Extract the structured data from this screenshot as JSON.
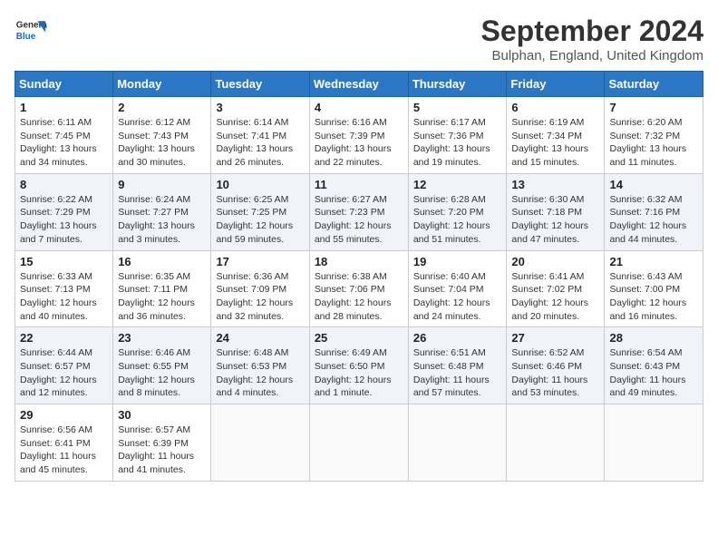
{
  "logo": {
    "line1": "General",
    "line2": "Blue"
  },
  "title": "September 2024",
  "subtitle": "Bulphan, England, United Kingdom",
  "header_days": [
    "Sunday",
    "Monday",
    "Tuesday",
    "Wednesday",
    "Thursday",
    "Friday",
    "Saturday"
  ],
  "weeks": [
    [
      {
        "day": "1",
        "info": "Sunrise: 6:11 AM\nSunset: 7:45 PM\nDaylight: 13 hours\nand 34 minutes."
      },
      {
        "day": "2",
        "info": "Sunrise: 6:12 AM\nSunset: 7:43 PM\nDaylight: 13 hours\nand 30 minutes."
      },
      {
        "day": "3",
        "info": "Sunrise: 6:14 AM\nSunset: 7:41 PM\nDaylight: 13 hours\nand 26 minutes."
      },
      {
        "day": "4",
        "info": "Sunrise: 6:16 AM\nSunset: 7:39 PM\nDaylight: 13 hours\nand 22 minutes."
      },
      {
        "day": "5",
        "info": "Sunrise: 6:17 AM\nSunset: 7:36 PM\nDaylight: 13 hours\nand 19 minutes."
      },
      {
        "day": "6",
        "info": "Sunrise: 6:19 AM\nSunset: 7:34 PM\nDaylight: 13 hours\nand 15 minutes."
      },
      {
        "day": "7",
        "info": "Sunrise: 6:20 AM\nSunset: 7:32 PM\nDaylight: 13 hours\nand 11 minutes."
      }
    ],
    [
      {
        "day": "8",
        "info": "Sunrise: 6:22 AM\nSunset: 7:29 PM\nDaylight: 13 hours\nand 7 minutes."
      },
      {
        "day": "9",
        "info": "Sunrise: 6:24 AM\nSunset: 7:27 PM\nDaylight: 13 hours\nand 3 minutes."
      },
      {
        "day": "10",
        "info": "Sunrise: 6:25 AM\nSunset: 7:25 PM\nDaylight: 12 hours\nand 59 minutes."
      },
      {
        "day": "11",
        "info": "Sunrise: 6:27 AM\nSunset: 7:23 PM\nDaylight: 12 hours\nand 55 minutes."
      },
      {
        "day": "12",
        "info": "Sunrise: 6:28 AM\nSunset: 7:20 PM\nDaylight: 12 hours\nand 51 minutes."
      },
      {
        "day": "13",
        "info": "Sunrise: 6:30 AM\nSunset: 7:18 PM\nDaylight: 12 hours\nand 47 minutes."
      },
      {
        "day": "14",
        "info": "Sunrise: 6:32 AM\nSunset: 7:16 PM\nDaylight: 12 hours\nand 44 minutes."
      }
    ],
    [
      {
        "day": "15",
        "info": "Sunrise: 6:33 AM\nSunset: 7:13 PM\nDaylight: 12 hours\nand 40 minutes."
      },
      {
        "day": "16",
        "info": "Sunrise: 6:35 AM\nSunset: 7:11 PM\nDaylight: 12 hours\nand 36 minutes."
      },
      {
        "day": "17",
        "info": "Sunrise: 6:36 AM\nSunset: 7:09 PM\nDaylight: 12 hours\nand 32 minutes."
      },
      {
        "day": "18",
        "info": "Sunrise: 6:38 AM\nSunset: 7:06 PM\nDaylight: 12 hours\nand 28 minutes."
      },
      {
        "day": "19",
        "info": "Sunrise: 6:40 AM\nSunset: 7:04 PM\nDaylight: 12 hours\nand 24 minutes."
      },
      {
        "day": "20",
        "info": "Sunrise: 6:41 AM\nSunset: 7:02 PM\nDaylight: 12 hours\nand 20 minutes."
      },
      {
        "day": "21",
        "info": "Sunrise: 6:43 AM\nSunset: 7:00 PM\nDaylight: 12 hours\nand 16 minutes."
      }
    ],
    [
      {
        "day": "22",
        "info": "Sunrise: 6:44 AM\nSunset: 6:57 PM\nDaylight: 12 hours\nand 12 minutes."
      },
      {
        "day": "23",
        "info": "Sunrise: 6:46 AM\nSunset: 6:55 PM\nDaylight: 12 hours\nand 8 minutes."
      },
      {
        "day": "24",
        "info": "Sunrise: 6:48 AM\nSunset: 6:53 PM\nDaylight: 12 hours\nand 4 minutes."
      },
      {
        "day": "25",
        "info": "Sunrise: 6:49 AM\nSunset: 6:50 PM\nDaylight: 12 hours\nand 1 minute."
      },
      {
        "day": "26",
        "info": "Sunrise: 6:51 AM\nSunset: 6:48 PM\nDaylight: 11 hours\nand 57 minutes."
      },
      {
        "day": "27",
        "info": "Sunrise: 6:52 AM\nSunset: 6:46 PM\nDaylight: 11 hours\nand 53 minutes."
      },
      {
        "day": "28",
        "info": "Sunrise: 6:54 AM\nSunset: 6:43 PM\nDaylight: 11 hours\nand 49 minutes."
      }
    ],
    [
      {
        "day": "29",
        "info": "Sunrise: 6:56 AM\nSunset: 6:41 PM\nDaylight: 11 hours\nand 45 minutes."
      },
      {
        "day": "30",
        "info": "Sunrise: 6:57 AM\nSunset: 6:39 PM\nDaylight: 11 hours\nand 41 minutes."
      },
      {
        "day": "",
        "info": ""
      },
      {
        "day": "",
        "info": ""
      },
      {
        "day": "",
        "info": ""
      },
      {
        "day": "",
        "info": ""
      },
      {
        "day": "",
        "info": ""
      }
    ]
  ]
}
